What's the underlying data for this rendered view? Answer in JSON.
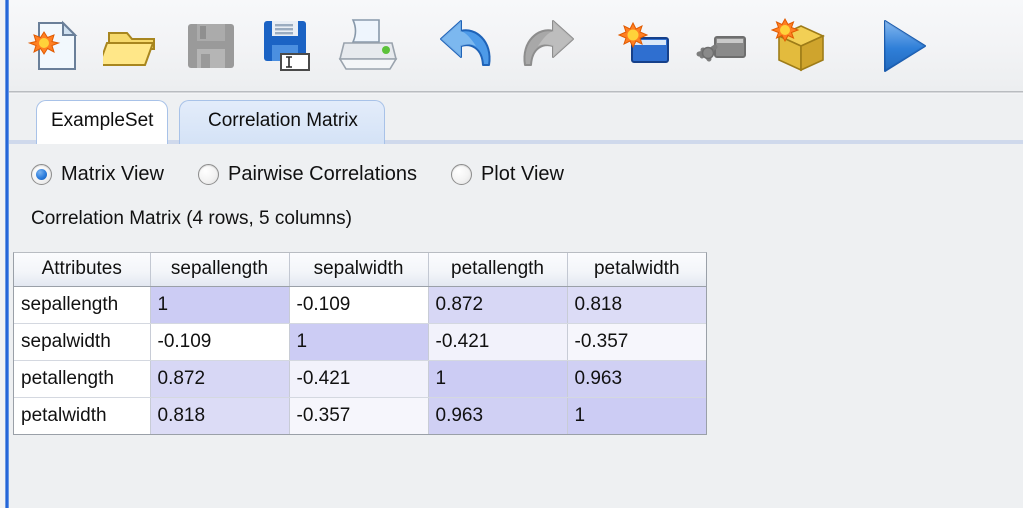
{
  "window": {
    "accent_border_color": "#1457d2",
    "background_color": "#eef0f2"
  },
  "toolbar": {
    "name": "main-toolbar",
    "buttons": [
      {
        "id": "new-process",
        "icon": "new-document-icon",
        "label": "New Process"
      },
      {
        "id": "open-process",
        "icon": "open-folder-icon",
        "label": "Open Process"
      },
      {
        "id": "save-process",
        "icon": "save-disk-icon",
        "label": "Save Process"
      },
      {
        "id": "save-process-as",
        "icon": "save-as-disk-icon",
        "label": "Save Process As"
      },
      {
        "id": "print",
        "icon": "printer-icon",
        "label": "Print"
      },
      {
        "id": "undo",
        "icon": "undo-arrow-icon",
        "label": "Undo"
      },
      {
        "id": "redo",
        "icon": "redo-arrow-icon",
        "label": "Redo"
      },
      {
        "id": "new-view",
        "icon": "new-window-icon",
        "label": "New Perspective"
      },
      {
        "id": "manage-views",
        "icon": "manage-window-icon",
        "label": "Manage Perspectives"
      },
      {
        "id": "manage-extensions",
        "icon": "package-box-icon",
        "label": "Manage Extensions"
      },
      {
        "id": "run-process",
        "icon": "play-triangle-icon",
        "label": "Run Process"
      }
    ]
  },
  "tabs": {
    "name": "result-tabs",
    "items": [
      {
        "id": "exampleset",
        "label": "ExampleSet",
        "selected": false
      },
      {
        "id": "correlation-matrix",
        "label": "Correlation Matrix",
        "selected": true
      }
    ]
  },
  "view_options": {
    "name": "view-mode-radio-group",
    "selected": "matrix-view",
    "items": [
      {
        "id": "matrix-view",
        "label": "Matrix View",
        "selected": true
      },
      {
        "id": "pairwise-correlations",
        "label": "Pairwise Correlations",
        "selected": false
      },
      {
        "id": "plot-view",
        "label": "Plot View",
        "selected": false
      }
    ]
  },
  "caption": "Correlation Matrix (4 rows, 5 columns)",
  "chart_data": {
    "type": "heatmap",
    "title": "Correlation Matrix (4 rows, 5 columns)",
    "columns": [
      "Attributes",
      "sepallength",
      "sepalwidth",
      "petallength",
      "petalwidth"
    ],
    "row_labels": [
      "sepallength",
      "sepalwidth",
      "petallength",
      "petalwidth"
    ],
    "values": [
      [
        "1",
        "-0.109",
        "0.872",
        "0.818"
      ],
      [
        "-0.109",
        "1",
        "-0.421",
        "-0.357"
      ],
      [
        "0.872",
        "-0.421",
        "1",
        "0.963"
      ],
      [
        "0.818",
        "-0.357",
        "0.963",
        "1"
      ]
    ],
    "numeric_values": [
      [
        1,
        -0.109,
        0.872,
        0.818
      ],
      [
        -0.109,
        1,
        -0.421,
        -0.357
      ],
      [
        0.872,
        -0.421,
        1,
        0.963
      ],
      [
        0.818,
        -0.357,
        0.963,
        1
      ]
    ],
    "cell_colors": [
      [
        "#ccccf4",
        "#ffffff",
        "#d7d7f5",
        "#dcdcf6"
      ],
      [
        "#ffffff",
        "#ccccf4",
        "#f2f2fb",
        "#f6f6fc"
      ],
      [
        "#d7d7f5",
        "#f2f2fb",
        "#ccccf4",
        "#d0d0f4"
      ],
      [
        "#dcdcf6",
        "#f6f6fc",
        "#d0d0f4",
        "#ccccf4"
      ]
    ],
    "colormap": "white-to-lavender by |correlation|",
    "legend": "none",
    "grid": true
  }
}
